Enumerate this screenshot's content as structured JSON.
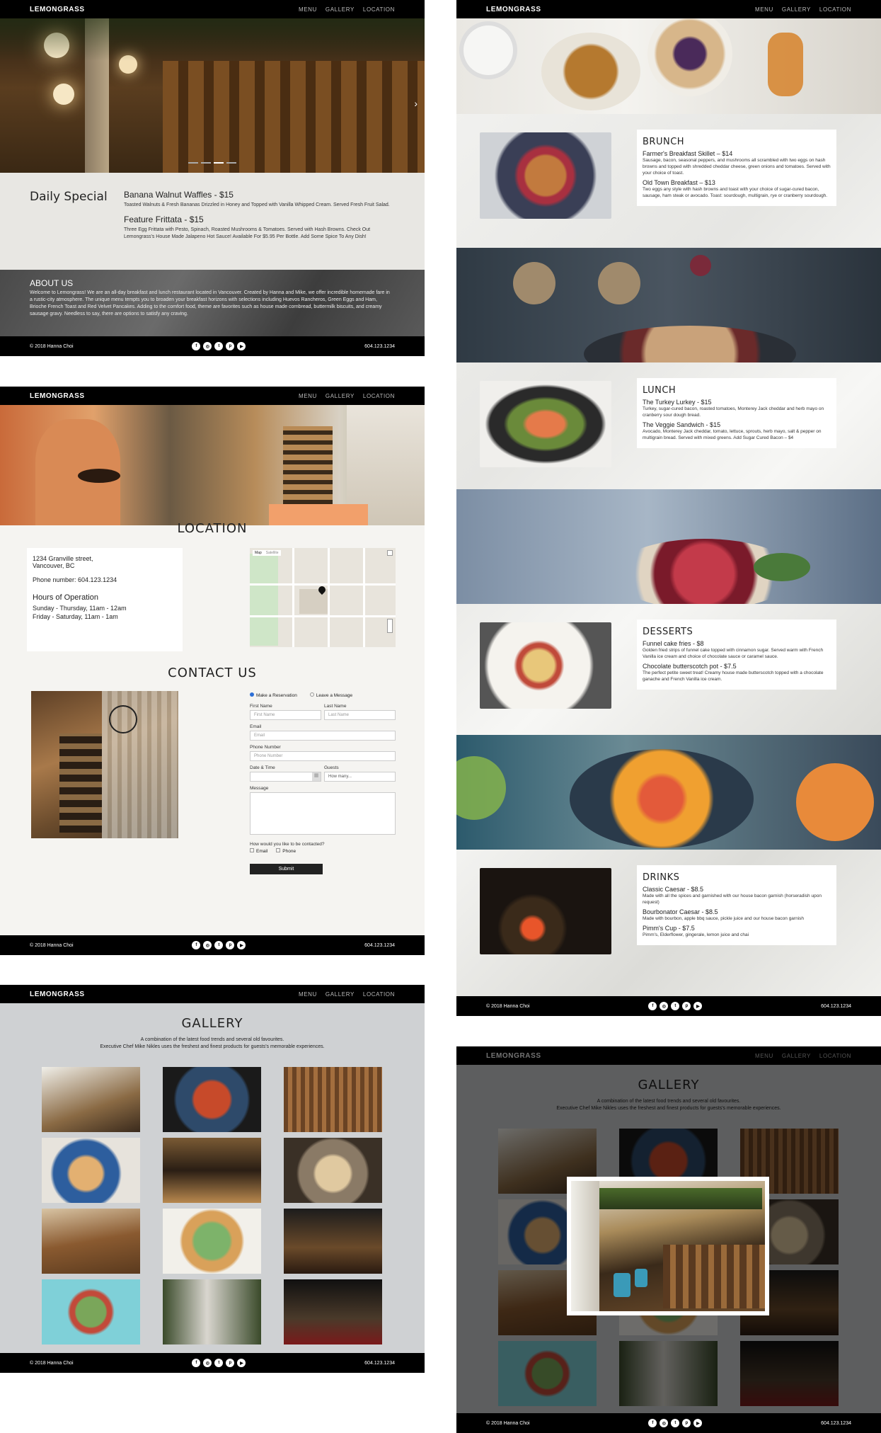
{
  "brand": "LEMONGRASS",
  "nav": [
    "MENU",
    "GALLERY",
    "LOCATION"
  ],
  "footer": {
    "copyright": "© 2018 Hanna Choi",
    "phone": "604.123.1234",
    "social_icons": [
      "facebook-icon",
      "instagram-icon",
      "twitter-icon",
      "pinterest-icon",
      "youtube-icon"
    ]
  },
  "home": {
    "special_heading": "Daily Special",
    "item1_title": "Banana Walnut Waffles - $15",
    "item1_desc": "Toasted Walnuts & Fresh Bananas Drizzled in Honey and Topped with Vanilla Whipped Cream. Served Fresh Fruit Salad.",
    "item2_title": "Feature Frittata - $15",
    "item2_desc": "Three Egg Frittata with Pesto, Spinach, Roasted Mushrooms & Tomatoes. Served with Hash Browns. Check Out Lemongrass's House Made Jalapeno Hot Sauce! Available For $5.95 Per Bottle. Add Some Spice To Any Dish!",
    "about_heading": "ABOUT US",
    "about_text": "Welcome to Lemongrass! We are an all-day breakfast and lunch restaurant located in Vancouver. Created by Hanna and Mike, we offer incredible homemade fare in a rustic-city atmosphere. The unique menu tempts you to broaden your breakfast horizons with selections including Huevos Rancheros, Green Eggs and Ham, Brioche French Toast and Red Velvet Pancakes. Adding to the comfort food, theme are favorites such as house made cornbread, buttermilk biscuits, and creamy sausage gravy. Needless to say, there are options to satisfy any craving."
  },
  "location": {
    "heading": "LOCATION",
    "address1": "1234 Granville street,",
    "address2": "Vancouver, BC",
    "phone": "Phone number: 604.123.1234",
    "hours_heading": "Hours of Operation",
    "hours1": "Sunday - Thursday, 11am - 12am",
    "hours2": "Friday - Saturday, 11am - 1am",
    "map_tab1": "Map",
    "map_tab2": "Satellite",
    "contact_heading": "CONTACT US",
    "radio1": "Make a Reservation",
    "radio2": "Leave a Message",
    "first_name_label": "First Name",
    "last_name_label": "Last Name",
    "first_name_ph": "First Name",
    "last_name_ph": "Last Name",
    "email_label": "Email",
    "email_ph": "Email",
    "phone_label": "Phone Number",
    "phone_ph": "Phone Number",
    "date_label": "Date & Time",
    "guests_label": "Guests",
    "guests_value": "How many...",
    "message_label": "Message",
    "contact_q": "How would you like to be contacted?",
    "check1": "Email",
    "check2": "Phone",
    "submit": "Submit"
  },
  "gallery": {
    "heading": "GALLERY",
    "line1": "A combination of the latest food trends and several old favourites.",
    "line2": "Executive Chef Mike Nikles uses the freshest and finest products for guests's memorable experiences."
  },
  "menu": {
    "brunch": {
      "heading": "BRUNCH",
      "i1": "Farmer's Breakfast Skillet – $14",
      "d1": "Sausage, bacon, seasonal peppers, and mushrooms all scrambled with two eggs on hash browns and topped with shredded cheddar cheese, green onions and tomatoes. Served with your choice of toast.",
      "i2": "Old Town Breakfast – $13",
      "d2": "Two eggs any style with hash browns and toast with your choice of sugar-cured bacon, sausage, ham steak or avocado. Toast: sourdough, multigrain, rye or cranberry sourdough."
    },
    "lunch": {
      "heading": "LUNCH",
      "i1": "The Turkey Lurkey - $15",
      "d1": "Turkey, sugar-cured bacon, roasted tomatoes, Monterey Jack cheddar and herb mayo on cranberry sour dough bread.",
      "i2": "The Veggie Sandwich - $15",
      "d2": "Avocado, Monterey Jack cheddar, tomato, lettuce, sprouts, herb mayo, salt & pepper on multigrain bread. Served with mixed greens. Add Sugar Cured Bacon – $4"
    },
    "desserts": {
      "heading": "DESSERTS",
      "i1": "Funnel cake fries - $8",
      "d1": "Golden fried strips of funnel cake topped with cinnamon sugar. Served warm with French Vanilla ice cream and choice of chocolate sauce or caramel sauce.",
      "i2": "Chocolate butterscotch pot - $7.5",
      "d2": "The perfect petite sweet treat! Creamy house made butterscotch topped with a chocolate ganache and French Vanilla ice cream."
    },
    "drinks": {
      "heading": "DRINKS",
      "i1": "Classic Caesar - $8.5",
      "d1": "Made with all the spices and garnished with our house bacon garnish (horseradish upon request)",
      "i2": "Bourbonator Caesar - $8.5",
      "d2": "Made with bourbon, apple bbq sauce, pickle juice and our house bacon garnish",
      "i3": "Pimm's Cup - $7.5",
      "d3": "Pimm's, Elderflower, gingerale, lemon juice and chai"
    }
  }
}
